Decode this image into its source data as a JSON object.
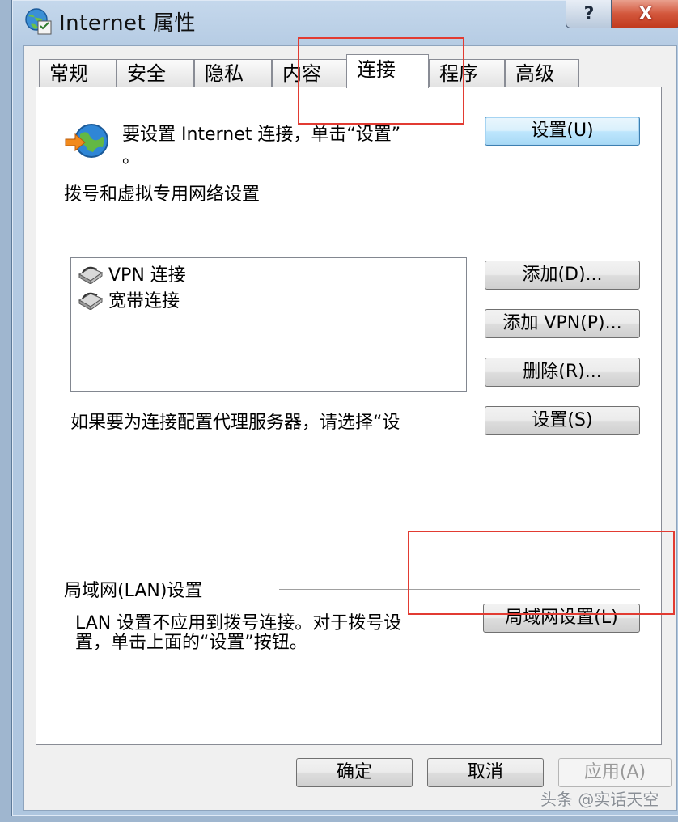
{
  "window": {
    "title": "Internet 属性"
  },
  "caption_buttons": {
    "help": "?",
    "close": "X"
  },
  "tabs": [
    {
      "label": "常规"
    },
    {
      "label": "安全"
    },
    {
      "label": "隐私"
    },
    {
      "label": "内容"
    },
    {
      "label": "连接",
      "active": true
    },
    {
      "label": "程序"
    },
    {
      "label": "高级"
    }
  ],
  "setup": {
    "text_line1": "要设置 Internet 连接，单击“设置”",
    "text_line2": "。",
    "button": "设置(U)"
  },
  "dialup": {
    "heading": "拨号和虚拟专用网络设置",
    "items": [
      {
        "label": "VPN 连接"
      },
      {
        "label": "宽带连接"
      }
    ],
    "add_button": "添加(D)...",
    "add_vpn_button": "添加 VPN(P)...",
    "remove_button": "删除(R)...",
    "proxy_text": "如果要为连接配置代理服务器，请选择“设",
    "settings_button": "设置(S)"
  },
  "lan": {
    "heading": "局域网(LAN)设置",
    "text_line1": "LAN 设置不应用到拨号连接。对于拨号设",
    "text_line2": "置，单击上面的“设置”按钮。",
    "button": "局域网设置(L)"
  },
  "footer": {
    "ok": "确定",
    "cancel": "取消",
    "apply": "应用(A)"
  },
  "watermark": "头条 @实话天空",
  "colors": {
    "highlight_box": "#e23b32",
    "accent": "#3c7fb1"
  }
}
